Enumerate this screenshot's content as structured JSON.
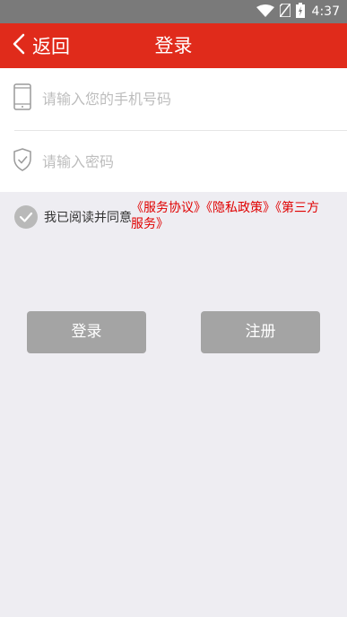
{
  "status_bar": {
    "time": "4:37"
  },
  "nav": {
    "back_label": "返回",
    "title": "登录"
  },
  "form": {
    "phone_placeholder": "请输入您的手机号码",
    "password_placeholder": "请输入密码"
  },
  "agreement": {
    "prefix": "我已阅读并同意",
    "links": [
      "《服务协议》",
      "《隐私政策》",
      "《第三方",
      "服务》"
    ]
  },
  "buttons": {
    "login_label": "登录",
    "register_label": "注册"
  },
  "colors": {
    "primary": "#e02b1b",
    "link": "#e00000",
    "button": "#a4a4a4",
    "background": "#eeedf2"
  }
}
